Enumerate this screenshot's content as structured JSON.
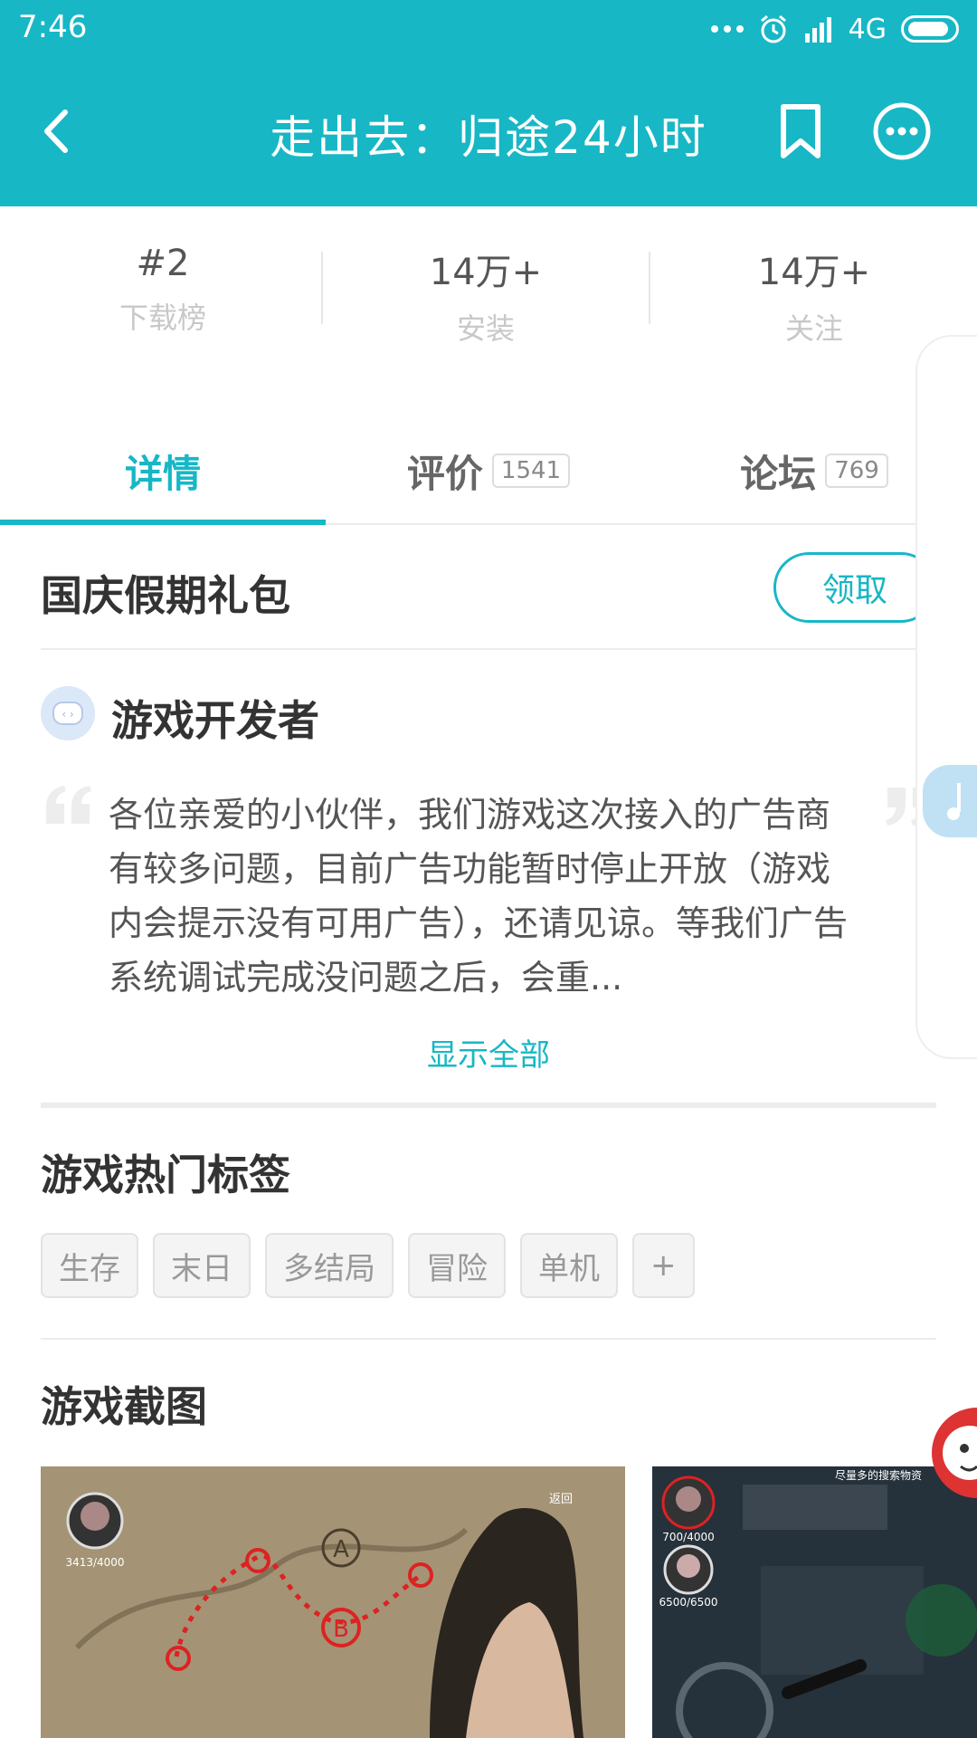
{
  "status": {
    "time": "7:46",
    "network": "4G"
  },
  "header": {
    "title": "走出去：归途24小时"
  },
  "stats": [
    {
      "value": "#2",
      "label": "下载榜"
    },
    {
      "value": "14万+",
      "label": "安装"
    },
    {
      "value": "14万+",
      "label": "关注"
    }
  ],
  "tabs": [
    {
      "label": "详情",
      "badge": ""
    },
    {
      "label": "评价",
      "badge": "1541"
    },
    {
      "label": "论坛",
      "badge": "769"
    }
  ],
  "gift": {
    "title": "国庆假期礼包",
    "button": "领取"
  },
  "developer": {
    "name": "游戏开发者",
    "notice": "各位亲爱的小伙伴，我们游戏这次接入的广告商有较多问题，目前广告功能暂时停止开放（游戏内会提示没有可用广告），还请见谅。等我们广告系统调试完成没问题之后，会重...",
    "show_all": "显示全部"
  },
  "tags": {
    "title": "游戏热门标签",
    "items": [
      "生存",
      "末日",
      "多结局",
      "冒险",
      "单机",
      "+"
    ]
  },
  "screenshots": {
    "title": "游戏截图",
    "shot1": {
      "hp": "3413/4000",
      "back": "返回"
    },
    "shot2": {
      "caption": "尽量多的搜索物资",
      "hp1": "700/4000",
      "hp2": "6500/6500"
    }
  },
  "colors": {
    "accent": "#17b7c6",
    "muted": "#c8c8c8"
  }
}
